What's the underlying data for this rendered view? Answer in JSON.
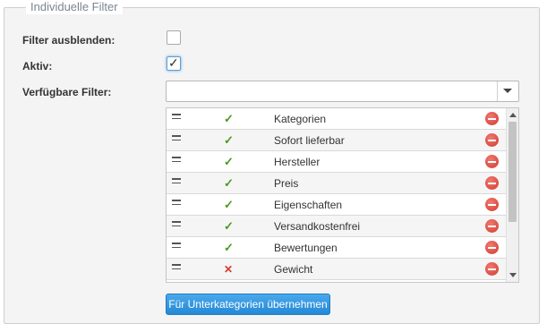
{
  "fieldset": {
    "legend": "Individuelle Filter"
  },
  "form": {
    "hide_filter_label": "Filter ausblenden:",
    "hide_filter_checked": false,
    "active_label": "Aktiv:",
    "active_checked": true,
    "available_filter_label": "Verfügbare Filter:",
    "available_filter_value": ""
  },
  "filters": [
    {
      "name": "Kategorien",
      "active": true,
      "status_icon": "check-icon"
    },
    {
      "name": "Sofort lieferbar",
      "active": true,
      "status_icon": "check-icon"
    },
    {
      "name": "Hersteller",
      "active": true,
      "status_icon": "check-icon"
    },
    {
      "name": "Preis",
      "active": true,
      "status_icon": "check-icon"
    },
    {
      "name": "Eigenschaften",
      "active": true,
      "status_icon": "check-icon"
    },
    {
      "name": "Versandkostenfrei",
      "active": true,
      "status_icon": "check-icon"
    },
    {
      "name": "Bewertungen",
      "active": true,
      "status_icon": "check-icon"
    },
    {
      "name": "Gewicht",
      "active": false,
      "status_icon": "cross-icon"
    }
  ],
  "apply_button": {
    "label": "Für Unterkategorien übernehmen"
  },
  "colors": {
    "accent": "#2489d6",
    "check": "#4a9a1f",
    "cross": "#d9382d",
    "delete": "#d33a2f"
  }
}
